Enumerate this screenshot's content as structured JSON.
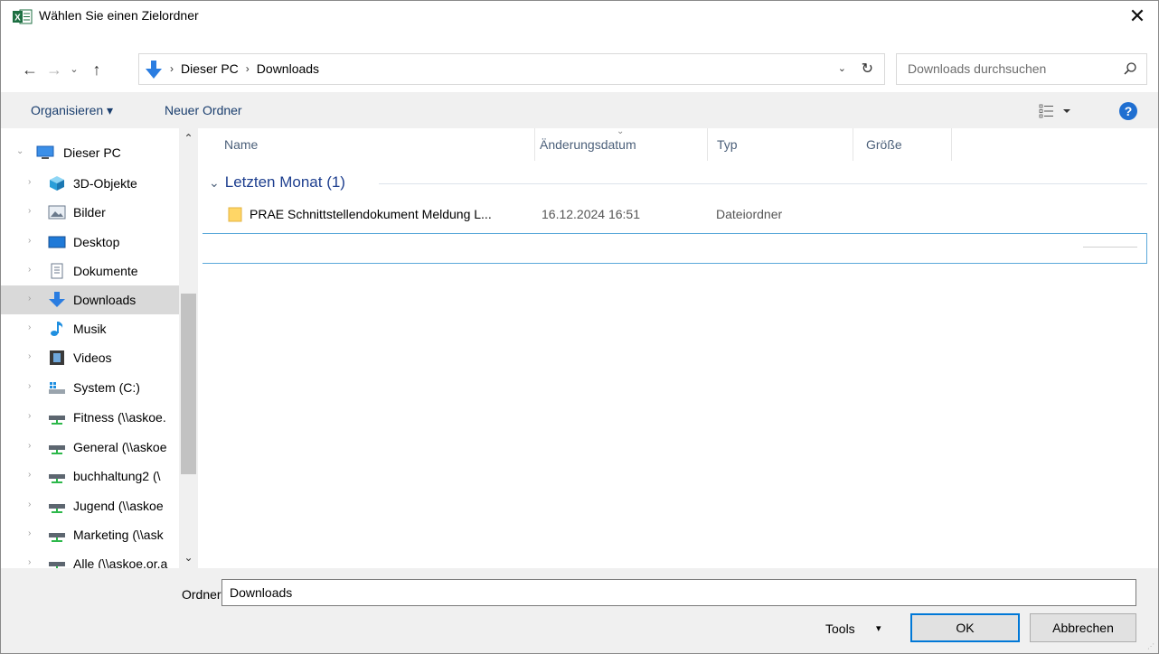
{
  "window": {
    "title": "Wählen Sie einen Zielordner",
    "close_glyph": "✕",
    "app_icon": "excel-icon"
  },
  "navigation": {
    "back_glyph": "←",
    "forward_glyph": "→",
    "recent_glyph": "⌄",
    "up_glyph": "↑"
  },
  "address": {
    "crumbs": [
      "Dieser PC",
      "Downloads"
    ],
    "separator": "›",
    "dropdown_glyph": "⌄",
    "refresh_glyph": "↻"
  },
  "search": {
    "placeholder": "Downloads durchsuchen"
  },
  "toolbar": {
    "organize_label": "Organisieren ▾",
    "new_folder_label": "Neuer Ordner",
    "help_label": "?"
  },
  "tree": {
    "items": [
      {
        "label": "Dieser PC",
        "icon": "monitor-icon",
        "expanded": true
      },
      {
        "label": "3D-Objekte",
        "icon": "cube-icon"
      },
      {
        "label": "Bilder",
        "icon": "pictures-icon"
      },
      {
        "label": "Desktop",
        "icon": "desktop-icon"
      },
      {
        "label": "Dokumente",
        "icon": "documents-icon"
      },
      {
        "label": "Downloads",
        "icon": "download-arrow-icon",
        "selected": true
      },
      {
        "label": "Musik",
        "icon": "music-note-icon"
      },
      {
        "label": "Videos",
        "icon": "film-icon"
      },
      {
        "label": "System (C:)",
        "icon": "drive-icon"
      },
      {
        "label": "Fitness (\\\\askoe.",
        "icon": "network-drive-icon"
      },
      {
        "label": "General (\\\\askoe",
        "icon": "network-drive-icon"
      },
      {
        "label": "buchhaltung2 (\\",
        "icon": "network-drive-icon"
      },
      {
        "label": "Jugend (\\\\askoe",
        "icon": "network-drive-icon"
      },
      {
        "label": "Marketing (\\\\ask",
        "icon": "network-drive-icon"
      },
      {
        "label": "Alle (\\\\askoe.or.a",
        "icon": "network-drive-icon"
      }
    ]
  },
  "columns": {
    "name": "Name",
    "date": "Änderungsdatum",
    "type": "Typ",
    "size": "Größe"
  },
  "group": {
    "label": "Letzten Monat (1)",
    "chevron": "⌄"
  },
  "files": [
    {
      "name": "PRAE Schnittstellendokument Meldung L...",
      "date": "16.12.2024 16:51",
      "type": "Dateiordner",
      "icon": "folder-icon"
    }
  ],
  "footer": {
    "folder_label": "Ordner:",
    "folder_value": "Downloads",
    "tools_label": "Tools",
    "tools_arrow": "▾",
    "ok_label": "OK",
    "cancel_label": "Abbrechen"
  }
}
